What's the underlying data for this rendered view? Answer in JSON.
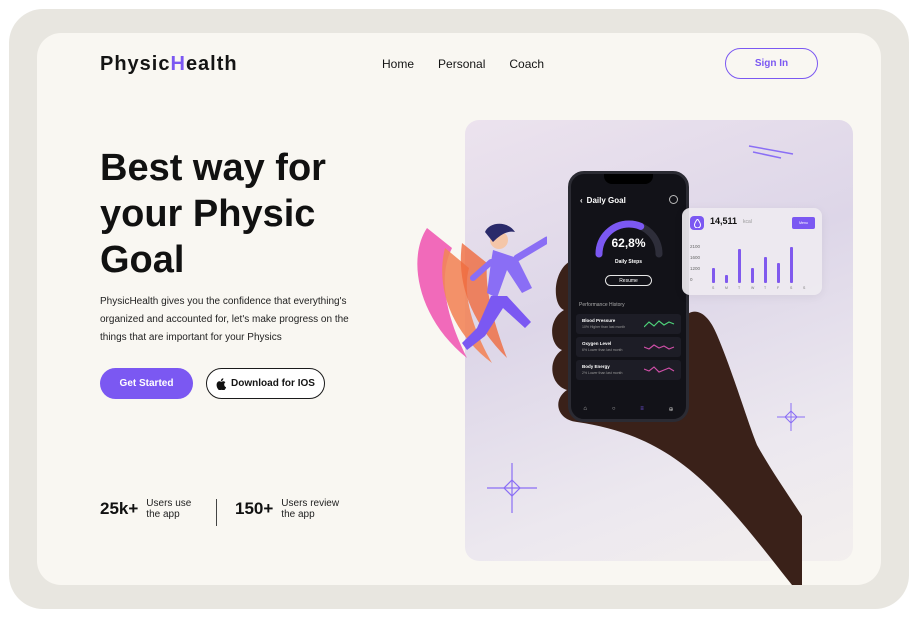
{
  "brand": {
    "prefix": "Physic",
    "accent_letter": "H",
    "suffix": "ealth",
    "accent_color": "#7b58f2"
  },
  "nav": {
    "items": [
      "Home",
      "Personal",
      "Coach"
    ],
    "signin_label": "Sign In"
  },
  "hero": {
    "heading": "Best way for your Physic Goal",
    "description": "PhysicHealth gives you the confidence that everything's organized and accounted for, let's make progress on the things that are important for your Physics",
    "primary_button": "Get Started",
    "secondary_button": "Download for IOS"
  },
  "stats": [
    {
      "value": "25k+",
      "label_line1": "Users use",
      "label_line2": "the app"
    },
    {
      "value": "150+",
      "label_line1": "Users review",
      "label_line2": "the app"
    }
  ],
  "phone": {
    "title": "Daily Goal",
    "percent": "62,8%",
    "percent_value": 62.8,
    "steps_label": "Daily Steps",
    "resume_label": "Resume",
    "history_label": "Performance History",
    "metrics": [
      {
        "name": "Blood Pressure",
        "sub": "10% Higher than last month",
        "color": "#4ed27a"
      },
      {
        "name": "Oxygen Level",
        "sub": "6% Lower than last month",
        "color": "#d04fa8"
      },
      {
        "name": "Body Energy",
        "sub": "2% Lower than last month",
        "color": "#d04fa8"
      }
    ],
    "tab_icons": [
      "home-icon",
      "chat-icon",
      "list-icon",
      "settings-icon"
    ]
  },
  "calorie_card": {
    "value": "14,511",
    "unit": "kcal",
    "button_label": "Menu",
    "y_labels": [
      "2100",
      "1600",
      "1200",
      "0"
    ],
    "x_labels": [
      "S",
      "M",
      "T",
      "W",
      "T",
      "F",
      "S",
      "S"
    ],
    "bar_values": [
      0.35,
      0.18,
      0.8,
      0.35,
      0.62,
      0.48,
      0.85,
      0.0
    ]
  }
}
